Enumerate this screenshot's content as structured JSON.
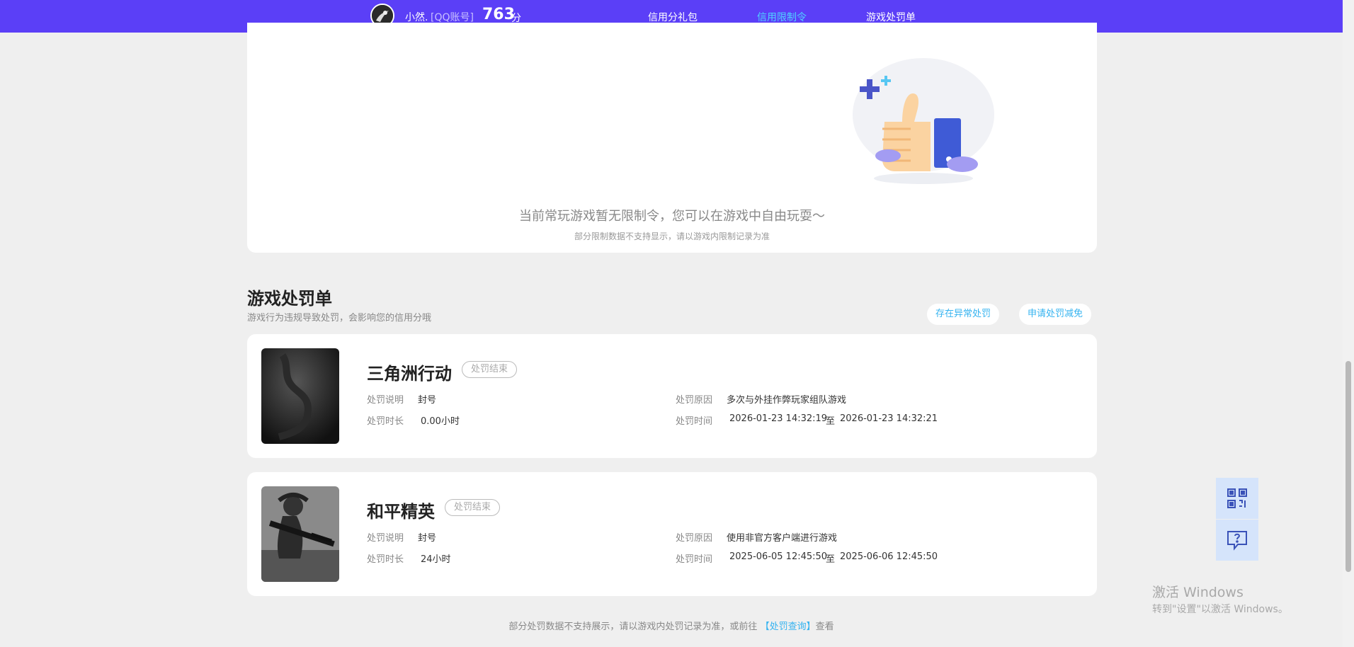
{
  "header": {
    "username": "小然.",
    "account_type": "[QQ账号]",
    "score": "763",
    "score_unit": "分",
    "nav": [
      {
        "label": "信用分礼包",
        "active": false
      },
      {
        "label": "信用限制令",
        "active": true
      },
      {
        "label": "游戏处罚单",
        "active": false
      }
    ]
  },
  "restriction": {
    "empty_title": "当前常玩游戏暂无限制令，您可以在游戏中自由玩耍～",
    "empty_note": "部分限制数据不支持显示，请以游戏内限制记录为准"
  },
  "penalties": {
    "title": "游戏处罚单",
    "description": "游戏行为违规导致处罚，会影响您的信用分哦",
    "actions": {
      "abnormal": "存在异常处罚",
      "apply": "申请处罚减免"
    },
    "labels": {
      "explain": "处罚说明",
      "duration": "处罚时长",
      "reason": "处罚原因",
      "time": "处罚时间",
      "to": "至"
    },
    "items": [
      {
        "game": "三角洲行动",
        "status": "处罚结束",
        "explain": "封号",
        "duration": "0.00小时",
        "reason": "多次与外挂作弊玩家组队游戏",
        "start": "2026-01-23 14:32:19",
        "end": "2026-01-23 14:32:21"
      },
      {
        "game": "和平精英",
        "status": "处罚结束",
        "explain": "封号",
        "duration": "24小时",
        "reason": "使用非官方客户端进行游戏",
        "start": "2025-06-05 12:45:50",
        "end": "2025-06-06 12:45:50"
      }
    ],
    "footer": {
      "text_before": "部分处罚数据不支持展示，请以游戏内处罚记录为准，或前往",
      "link": "【处罚查询】",
      "text_after": "查看"
    }
  },
  "side_buttons": [
    {
      "icon": "qr-code-icon"
    },
    {
      "icon": "feedback-icon"
    }
  ],
  "watermark": {
    "line1": "激活 Windows",
    "line2": "转到\"设置\"以激活 Windows。"
  }
}
